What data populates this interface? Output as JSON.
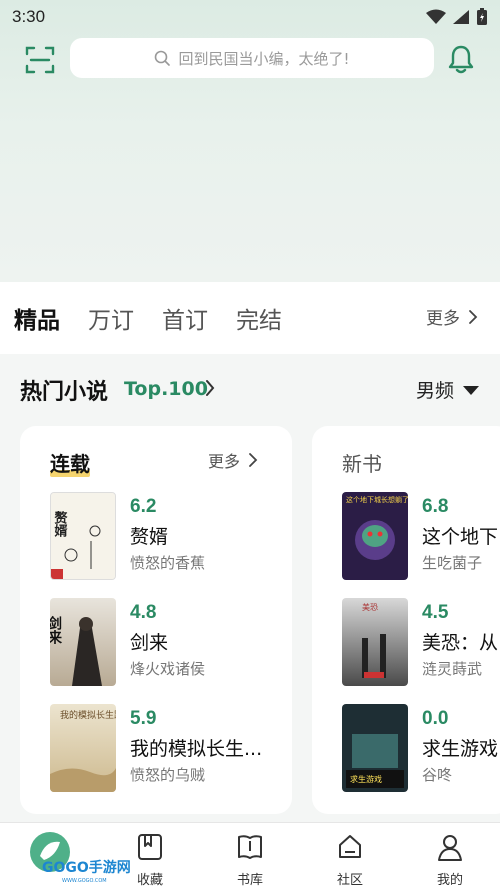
{
  "status_bar": {
    "time": "3:30"
  },
  "search": {
    "placeholder": "回到民国当小编，太绝了!"
  },
  "tabs": [
    {
      "label": "精品",
      "active": true
    },
    {
      "label": "万订",
      "active": false
    },
    {
      "label": "首订",
      "active": false
    },
    {
      "label": "完结",
      "active": false
    }
  ],
  "tabs_more": "更多",
  "section": {
    "title": "热门小说",
    "top_label": "Top.100",
    "gender": "男频"
  },
  "cards": [
    {
      "title": "连载",
      "more": "更多",
      "books": [
        {
          "score": "6.2",
          "title": "赘婿",
          "author": "愤怒的香蕉"
        },
        {
          "score": "4.8",
          "title": "剑来",
          "author": "烽火戏诸侯"
        },
        {
          "score": "5.9",
          "title": "我的模拟长生...",
          "author": "愤怒的乌贼"
        }
      ]
    },
    {
      "title": "新书",
      "books": [
        {
          "score": "6.8",
          "title": "这个地下",
          "author": "生吃菌子"
        },
        {
          "score": "4.5",
          "title": "美恐：从",
          "author": "涟灵蒔武"
        },
        {
          "score": "0.0",
          "title": "求生游戏",
          "author": "谷咚"
        }
      ]
    }
  ],
  "cover_texts": {
    "zhuixu": "赘婿",
    "jianlai": "剑来",
    "moni": "我的模拟长生路",
    "dixia": "这个地下城长想躺了",
    "meikong": "美恐",
    "qiusheng": "求生游戏"
  },
  "bottom_nav": [
    {
      "label": "收藏",
      "icon": "bookmark-icon"
    },
    {
      "label": "书库",
      "icon": "book-open-icon"
    },
    {
      "label": "社区",
      "icon": "community-icon"
    },
    {
      "label": "我的",
      "icon": "user-icon"
    }
  ],
  "watermark": {
    "text": "GOGO手游网",
    "sub": "WWW.GOGO.COM"
  },
  "colors": {
    "accent": "#2a8a63",
    "highlight": "#f3c94a"
  }
}
